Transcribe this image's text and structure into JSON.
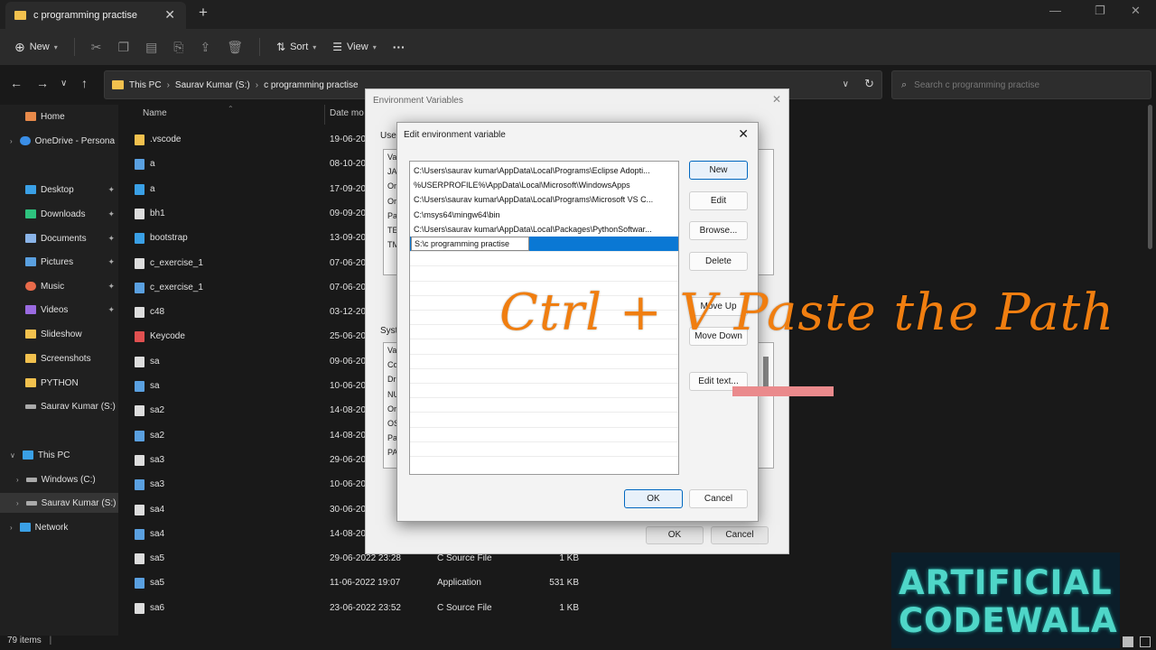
{
  "window": {
    "tab_title": "c programming practise",
    "new_tab": "+",
    "controls": [
      "—",
      "❐",
      "✕"
    ]
  },
  "toolbar": {
    "new_label": "New",
    "sort_label": "Sort",
    "view_label": "View",
    "more": "···"
  },
  "address": {
    "crumbs": [
      "This PC",
      "Saurav Kumar (S:)",
      "c programming practise"
    ],
    "search_placeholder": "Search c programming practise"
  },
  "sidebar": {
    "items": [
      {
        "label": "Home",
        "color": "#e88a4a",
        "pin": false
      },
      {
        "label": "OneDrive - Persona",
        "color": "#3a8ee6",
        "pin": false
      },
      {
        "label": "Desktop",
        "color": "#3aa0e6",
        "pin": true
      },
      {
        "label": "Downloads",
        "color": "#2ec27e",
        "pin": true
      },
      {
        "label": "Documents",
        "color": "#8ab4e8",
        "pin": true
      },
      {
        "label": "Pictures",
        "color": "#5aa0e0",
        "pin": true
      },
      {
        "label": "Music",
        "color": "#e86a4a",
        "pin": true
      },
      {
        "label": "Videos",
        "color": "#9a6ae0",
        "pin": true
      },
      {
        "label": "Slideshow",
        "color": "#f2c14e",
        "pin": false
      },
      {
        "label": "Screenshots",
        "color": "#f2c14e",
        "pin": false
      },
      {
        "label": "PYTHON",
        "color": "#f2c14e",
        "pin": false
      },
      {
        "label": "Saurav Kumar (S:)",
        "color": "#aaaaaa",
        "pin": false
      },
      {
        "label": "This PC",
        "color": "#3aa0e6",
        "pin": false
      },
      {
        "label": "Windows (C:)",
        "color": "#aaaaaa",
        "pin": false
      },
      {
        "label": "Saurav Kumar (S:)",
        "color": "#aaaaaa",
        "pin": false
      },
      {
        "label": "Network",
        "color": "#3aa0e6",
        "pin": false
      }
    ]
  },
  "files": {
    "col_name": "Name",
    "col_date": "Date mo",
    "rows": [
      {
        "name": ".vscode",
        "date": "19-06-20",
        "type": "",
        "size": "",
        "color": "#f2c14e"
      },
      {
        "name": "a",
        "date": "08-10-20",
        "type": "",
        "size": "",
        "color": "#5aa0e0"
      },
      {
        "name": "a",
        "date": "17-09-20",
        "type": "",
        "size": "",
        "color": "#3aa0e6"
      },
      {
        "name": "bh1",
        "date": "09-09-20",
        "type": "",
        "size": "",
        "color": "#dddddd"
      },
      {
        "name": "bootstrap",
        "date": "13-09-20",
        "type": "",
        "size": "",
        "color": "#3aa0e6"
      },
      {
        "name": "c_exercise_1",
        "date": "07-06-20",
        "type": "",
        "size": "",
        "color": "#dddddd"
      },
      {
        "name": "c_exercise_1",
        "date": "07-06-20",
        "type": "",
        "size": "",
        "color": "#5aa0e0"
      },
      {
        "name": "c48",
        "date": "03-12-20",
        "type": "",
        "size": "",
        "color": "#dddddd"
      },
      {
        "name": "Keycode",
        "date": "25-06-20",
        "type": "",
        "size": "",
        "color": "#e05050"
      },
      {
        "name": "sa",
        "date": "09-06-20",
        "type": "",
        "size": "",
        "color": "#dddddd"
      },
      {
        "name": "sa",
        "date": "10-06-20",
        "type": "",
        "size": "",
        "color": "#5aa0e0"
      },
      {
        "name": "sa2",
        "date": "14-08-20",
        "type": "",
        "size": "",
        "color": "#dddddd"
      },
      {
        "name": "sa2",
        "date": "14-08-20",
        "type": "",
        "size": "",
        "color": "#5aa0e0"
      },
      {
        "name": "sa3",
        "date": "29-06-20",
        "type": "",
        "size": "",
        "color": "#dddddd"
      },
      {
        "name": "sa3",
        "date": "10-06-20",
        "type": "",
        "size": "",
        "color": "#5aa0e0"
      },
      {
        "name": "sa4",
        "date": "30-06-20",
        "type": "",
        "size": "",
        "color": "#dddddd"
      },
      {
        "name": "sa4",
        "date": "14-08-20",
        "type": "",
        "size": "",
        "color": "#5aa0e0"
      },
      {
        "name": "sa5",
        "date": "29-06-2022 23:28",
        "type": "C Source File",
        "size": "1 KB",
        "color": "#dddddd"
      },
      {
        "name": "sa5",
        "date": "11-06-2022 19:07",
        "type": "Application",
        "size": "531 KB",
        "color": "#5aa0e0"
      },
      {
        "name": "sa6",
        "date": "23-06-2022 23:52",
        "type": "C Source File",
        "size": "1 KB",
        "color": "#dddddd"
      }
    ]
  },
  "status": {
    "items_count": "79 items"
  },
  "env_dialog": {
    "title": "Environment Variables",
    "user_label": "User",
    "system_label": "Syste",
    "user_vars": [
      "Va",
      "JA",
      "Or",
      "Or",
      "Pa",
      "TE",
      "TM"
    ],
    "system_vars": [
      "Va",
      "Co",
      "Dr",
      "NU",
      "Or",
      "OS",
      "Pa",
      "PA"
    ],
    "ok_label": "OK",
    "cancel_label": "Cancel"
  },
  "edit_dialog": {
    "title": "Edit environment variable",
    "paths": [
      "C:\\Users\\saurav kumar\\AppData\\Local\\Programs\\Eclipse Adopti...",
      "%USERPROFILE%\\AppData\\Local\\Microsoft\\WindowsApps",
      "C:\\Users\\saurav kumar\\AppData\\Local\\Programs\\Microsoft VS C...",
      "C:\\msys64\\mingw64\\bin",
      "C:\\Users\\saurav kumar\\AppData\\Local\\Packages\\PythonSoftwar..."
    ],
    "editing_value": "S:\\c programming practise",
    "buttons": {
      "new": "New",
      "edit": "Edit",
      "browse": "Browse...",
      "delete": "Delete",
      "move_up": "Move Up",
      "move_down": "Move Down",
      "edit_text": "Edit text..."
    },
    "ok_label": "OK",
    "cancel_label": "Cancel"
  },
  "overlay": {
    "caption": "Ctrl + V Paste the Path",
    "logo_line1": "ARTIFICIAL",
    "logo_line2": "CODEWALA"
  }
}
